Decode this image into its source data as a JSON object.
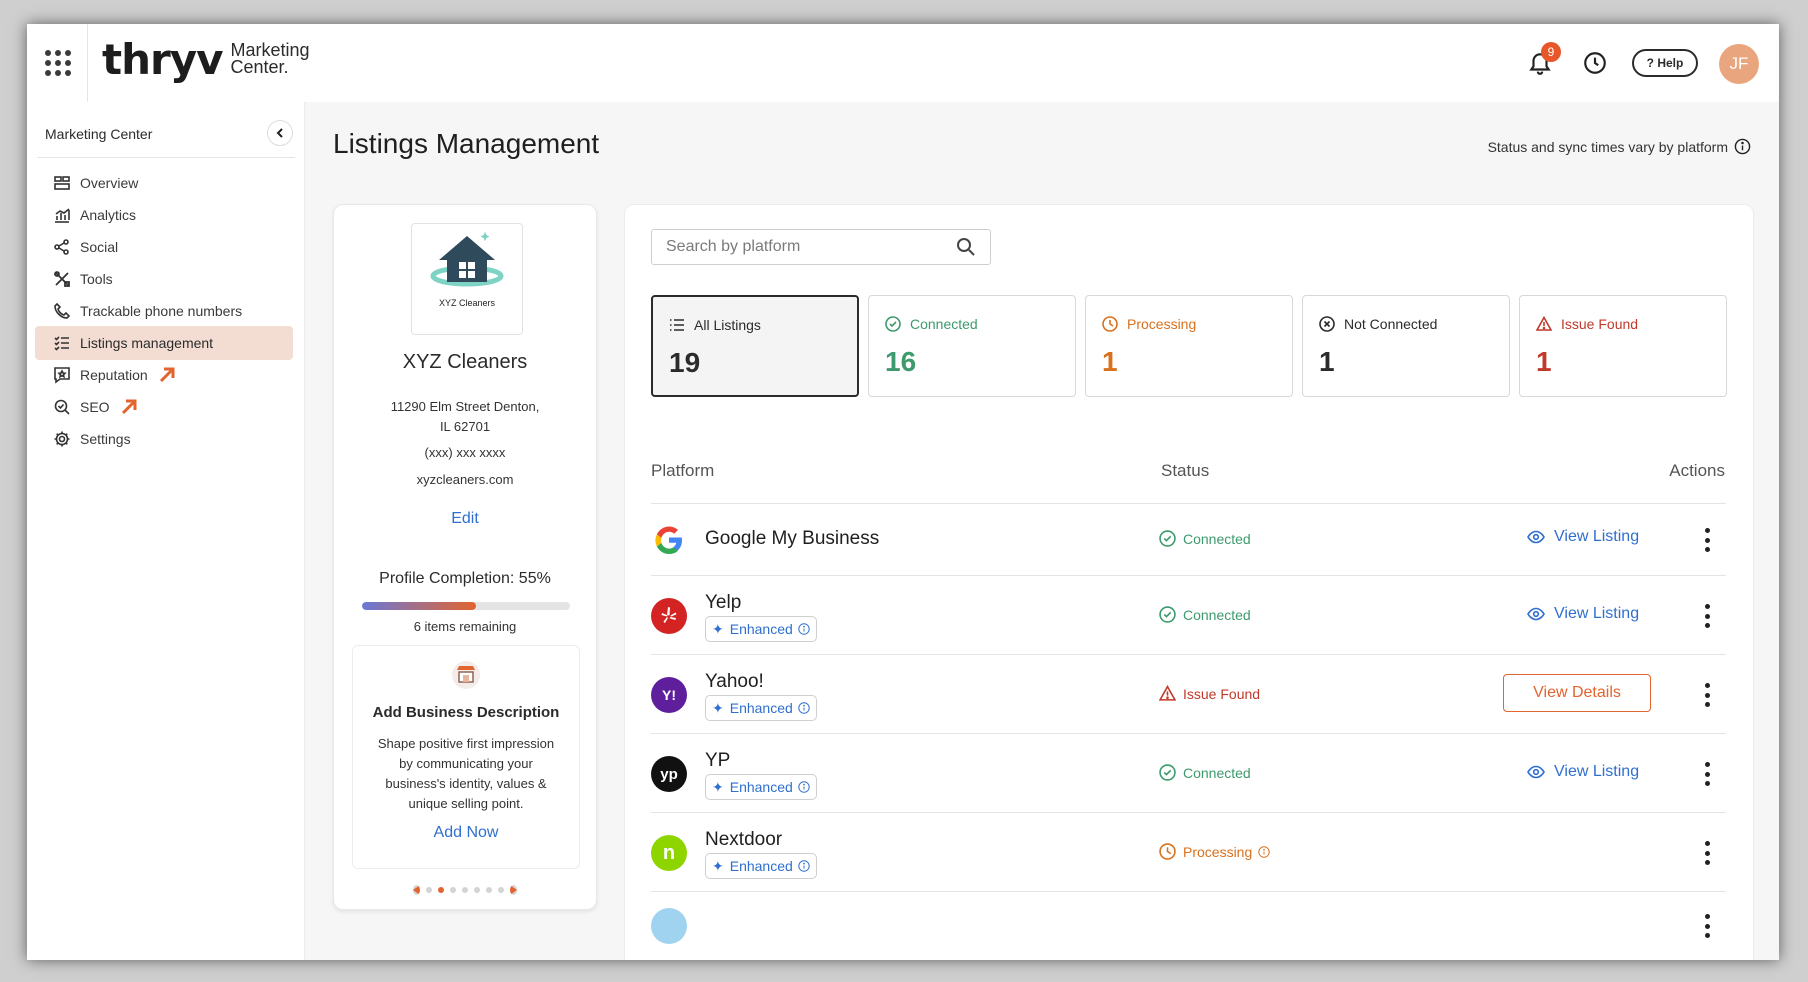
{
  "topbar": {
    "logo_main": "thryv",
    "logo_sub_line1": "Marketing",
    "logo_sub_line2": "Center.",
    "notifications_count": "9",
    "help_label": "? Help",
    "avatar_initials": "JF"
  },
  "sidebar": {
    "header": "Marketing Center",
    "items": [
      {
        "label": "Overview",
        "icon": "overview-icon"
      },
      {
        "label": "Analytics",
        "icon": "analytics-icon"
      },
      {
        "label": "Social",
        "icon": "share-icon"
      },
      {
        "label": "Tools",
        "icon": "tools-icon"
      },
      {
        "label": "Trackable phone numbers",
        "icon": "phone-icon"
      },
      {
        "label": "Listings management",
        "icon": "checklist-icon",
        "active": true
      },
      {
        "label": "Reputation",
        "icon": "star-message-icon",
        "external": true
      },
      {
        "label": "SEO",
        "icon": "seo-icon",
        "external": true
      },
      {
        "label": "Settings",
        "icon": "gear-icon"
      }
    ],
    "active_color": "#f3ddd3",
    "external_arrow_color": "#e2642f"
  },
  "page": {
    "title": "Listings Management",
    "status_note": "Status and sync times vary by platform"
  },
  "profile": {
    "logo_caption": "XYZ Cleaners",
    "name": "XYZ Cleaners",
    "address_line1": "11290 Elm Street Denton,",
    "address_line2": "IL 62701",
    "phone": "(xxx) xxx xxxx",
    "website": "xyzcleaners.com",
    "edit_label": "Edit",
    "completion_label": "Profile Completion: 55%",
    "completion_value": 0.55,
    "remaining_label": "6 items remaining",
    "task": {
      "title": "Add Business Description",
      "body_lines": [
        "Shape positive first impression",
        "by communicating your",
        "business's identity, values &",
        "unique selling point."
      ],
      "cta": "Add Now"
    },
    "carousel_active_index": 1,
    "carousel_count": 7
  },
  "listings": {
    "search_placeholder": "Search by platform",
    "filters": [
      {
        "label": "All Listings",
        "count": "19",
        "icon": "list-icon",
        "color": "#2b2b2b",
        "active": true
      },
      {
        "label": "Connected",
        "count": "16",
        "icon": "check-circle-icon",
        "color": "#3d9a6c"
      },
      {
        "label": "Processing",
        "count": "1",
        "icon": "clock-icon",
        "color": "#d9711c"
      },
      {
        "label": "Not Connected",
        "count": "1",
        "icon": "x-circle-icon",
        "color": "#2b2b2b"
      },
      {
        "label": "Issue Found",
        "count": "1",
        "icon": "warning-icon",
        "color": "#c0392b"
      }
    ],
    "columns": {
      "platform": "Platform",
      "status": "Status",
      "actions": "Actions"
    },
    "enhanced_label": "Enhanced",
    "rows": [
      {
        "platform": "Google My Business",
        "status": "Connected",
        "action": "View Listing",
        "enhanced": false
      },
      {
        "platform": "Yelp",
        "status": "Connected",
        "action": "View Listing",
        "enhanced": true
      },
      {
        "platform": "Yahoo!",
        "status": "Issue Found",
        "action": "View Details",
        "enhanced": true
      },
      {
        "platform": "YP",
        "status": "Connected",
        "action": "View Listing",
        "enhanced": true
      },
      {
        "platform": "Nextdoor",
        "status": "Processing",
        "action": "",
        "enhanced": true
      }
    ]
  }
}
